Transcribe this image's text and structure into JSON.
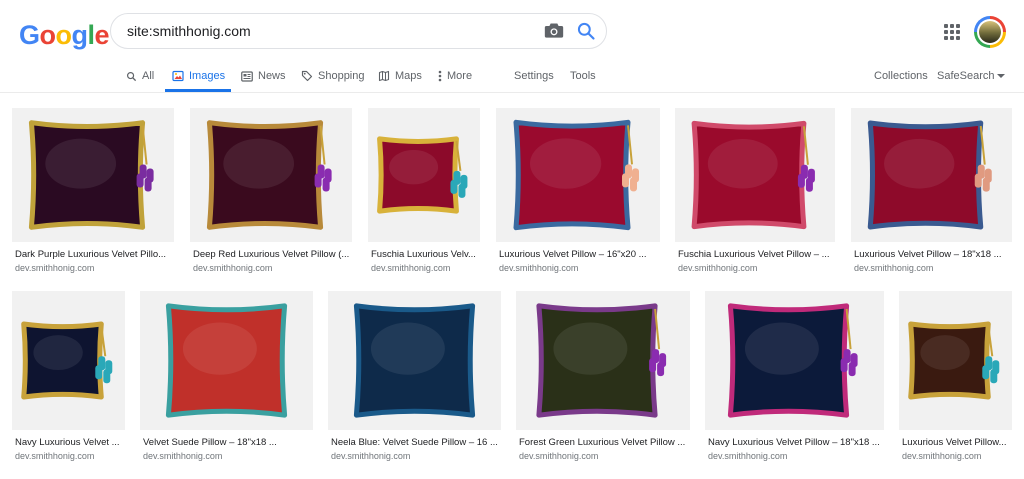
{
  "logo": {
    "letters": [
      "G",
      "o",
      "o",
      "g",
      "l",
      "e"
    ],
    "colors": [
      "#4285f4",
      "#ea4335",
      "#fbbc05",
      "#4285f4",
      "#34a853",
      "#ea4335"
    ]
  },
  "search": {
    "query": "site:smithhonig.com"
  },
  "tabs": [
    {
      "label": "All",
      "icon": "search-icon"
    },
    {
      "label": "Images",
      "icon": "image-icon"
    },
    {
      "label": "News",
      "icon": "news-icon"
    },
    {
      "label": "Shopping",
      "icon": "tag-icon"
    },
    {
      "label": "Maps",
      "icon": "map-icon"
    },
    {
      "label": "More",
      "icon": "kebab-icon"
    },
    {
      "label": "Settings"
    },
    {
      "label": "Tools"
    }
  ],
  "right": {
    "collections": "Collections",
    "safesearch": "SafeSearch"
  },
  "accent": "#1a73e8",
  "results": [
    {
      "caption": "Dark Purple Luxurious Velvet Pillo...",
      "source": "dev.smithhonig.com",
      "color": "#2a0a22",
      "trim": "#c0a23a",
      "tassel": "#7a2ca0"
    },
    {
      "caption": "Deep Red Luxurious Velvet Pillow (...",
      "source": "dev.smithhonig.com",
      "color": "#3a0a1e",
      "trim": "#b88a3a",
      "tassel": "#8a2cb0"
    },
    {
      "caption": "Fuschia Luxurious Velv...",
      "source": "dev.smithhonig.com",
      "color": "#8c0a2a",
      "trim": "#d8b23a",
      "tassel": "#2aa8b8"
    },
    {
      "caption": "Luxurious Velvet Pillow – 16\"x20 ...",
      "source": "dev.smithhonig.com",
      "color": "#9a0a2e",
      "trim": "#3a6aa0",
      "tassel": "#f0b090"
    },
    {
      "caption": "Fuschia Luxurious Velvet Pillow – ...",
      "source": "dev.smithhonig.com",
      "color": "#9a0a2c",
      "trim": "#d04a6a",
      "tassel": "#8a2cb0"
    },
    {
      "caption": "Luxurious Velvet Pillow – 18\"x18 ...",
      "source": "dev.smithhonig.com",
      "color": "#8e0a2a",
      "trim": "#3a5a90",
      "tassel": "#e09a80"
    },
    {
      "caption": "Navy Luxurious Velvet ...",
      "source": "dev.smithhonig.com",
      "color": "#0e1430",
      "trim": "#c8a23a",
      "tassel": "#2aa8b8"
    },
    {
      "caption": "Velvet Suede Pillow – 18\"x18 ...",
      "source": "dev.smithhonig.com",
      "color": "#c0302a",
      "trim": "#3aa0a0",
      "tassel": ""
    },
    {
      "caption": "Neela Blue: Velvet Suede Pillow – 16 ...",
      "source": "dev.smithhonig.com",
      "color": "#0e2a4a",
      "trim": "#1a5a8a",
      "tassel": ""
    },
    {
      "caption": "Forest Green Luxurious Velvet Pillow ...",
      "source": "dev.smithhonig.com",
      "color": "#2a3018",
      "trim": "#7a3a8a",
      "tassel": "#8a2cb0"
    },
    {
      "caption": "Navy Luxurious Velvet Pillow – 18\"x18 ...",
      "source": "dev.smithhonig.com",
      "color": "#0c1a3a",
      "trim": "#c02a7a",
      "tassel": "#8a2cb0"
    },
    {
      "caption": "Luxurious Velvet Pillow...",
      "source": "dev.smithhonig.com",
      "color": "#3a1a10",
      "trim": "#c8a23a",
      "tassel": "#2aa8b8"
    }
  ]
}
